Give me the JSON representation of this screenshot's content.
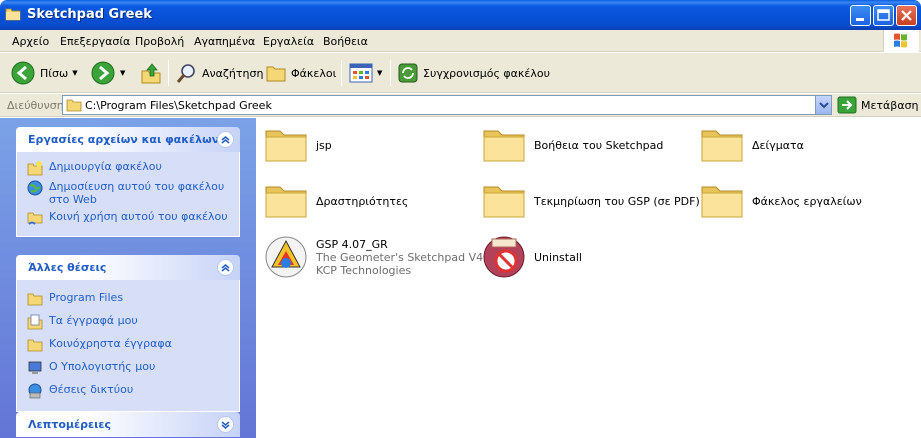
{
  "window": {
    "title": "Sketchpad Greek",
    "minimize_icon": "minimize-icon",
    "maximize_icon": "maximize-icon",
    "close_icon": "close-icon"
  },
  "menu": [
    "Αρχείο",
    "Επεξεργασία",
    "Προβολή",
    "Αγαπημένα",
    "Εργαλεία",
    "Βοήθεια"
  ],
  "toolbar": {
    "back": "Πίσω",
    "search": "Αναζήτηση",
    "folders": "Φάκελοι",
    "sync": "Συγχρονισμός φακέλου"
  },
  "address": {
    "label": "Διεύθυνση",
    "path": "C:\\Program Files\\Sketchpad Greek",
    "go": "Μετάβαση"
  },
  "panels": {
    "tasks": {
      "title": "Εργασίες αρχείων και φακέλων",
      "items": [
        "Δημιουργία φακέλου",
        "Δημοσίευση αυτού του φακέλου",
        "στο Web",
        "Κοινή χρήση αυτού του φακέλου"
      ]
    },
    "places": {
      "title": "Άλλες θέσεις",
      "items": [
        "Program Files",
        "Τα έγγραφά μου",
        "Κοινόχρηστα έγγραφα",
        "Ο Υπολογιστής μου",
        "Θέσεις δικτύου"
      ]
    },
    "details": {
      "title": "Λεπτομέρειες"
    }
  },
  "files": [
    {
      "name": "jsp",
      "icon": "folder-icon"
    },
    {
      "name": "Βοήθεια του Sketchpad",
      "icon": "folder-icon"
    },
    {
      "name": "Δείγματα",
      "icon": "folder-icon"
    },
    {
      "name": "Δραστηριότητες",
      "icon": "folder-icon"
    },
    {
      "name": "Τεκμηρίωση του GSP (σε PDF)",
      "icon": "folder-icon"
    },
    {
      "name": "Φάκελος εργαλείων",
      "icon": "folder-icon"
    },
    {
      "name": "GSP 4.07_GR",
      "desc": "The Geometer's Sketchpad V4",
      "company": "KCP Technologies",
      "icon": "gsp-app-icon"
    },
    {
      "name": "Uninstall",
      "icon": "uninstall-icon"
    }
  ]
}
